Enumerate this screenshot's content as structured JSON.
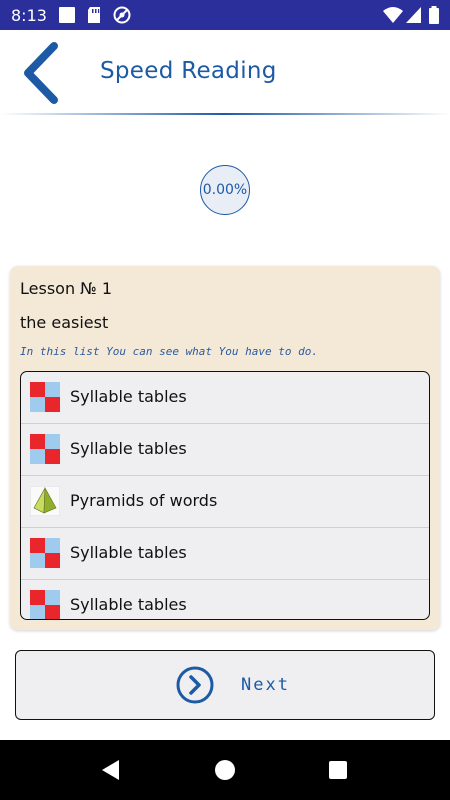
{
  "status_bar": {
    "time": "8:13",
    "icons": [
      "app-icon",
      "sd-card-icon",
      "vpn-icon"
    ],
    "right_icons": [
      "wifi-icon",
      "signal-icon",
      "battery-icon"
    ]
  },
  "header": {
    "back_icon": "chevron-left-icon",
    "title": "Speed Reading",
    "accent": "#1d5aa5"
  },
  "progress": {
    "label": "0.00%",
    "value": 0
  },
  "lesson": {
    "title": "Lesson № 1",
    "subtitle": "the easiest",
    "hint": "In this list You can see what You have to do.",
    "background": "#f4e9d6",
    "items": [
      {
        "label": "Syllable tables",
        "icon": "syllable-table-icon"
      },
      {
        "label": "Syllable tables",
        "icon": "syllable-table-icon"
      },
      {
        "label": "Pyramids of words",
        "icon": "pyramid-icon"
      },
      {
        "label": "Syllable tables",
        "icon": "syllable-table-icon"
      },
      {
        "label": "Syllable tables",
        "icon": "syllable-table-icon"
      }
    ]
  },
  "next_button": {
    "label": "Next",
    "icon": "chevron-right-circle-icon"
  },
  "nav_bar": {
    "back": "back-triangle-icon",
    "home": "home-circle-icon",
    "recents": "recents-square-icon"
  }
}
